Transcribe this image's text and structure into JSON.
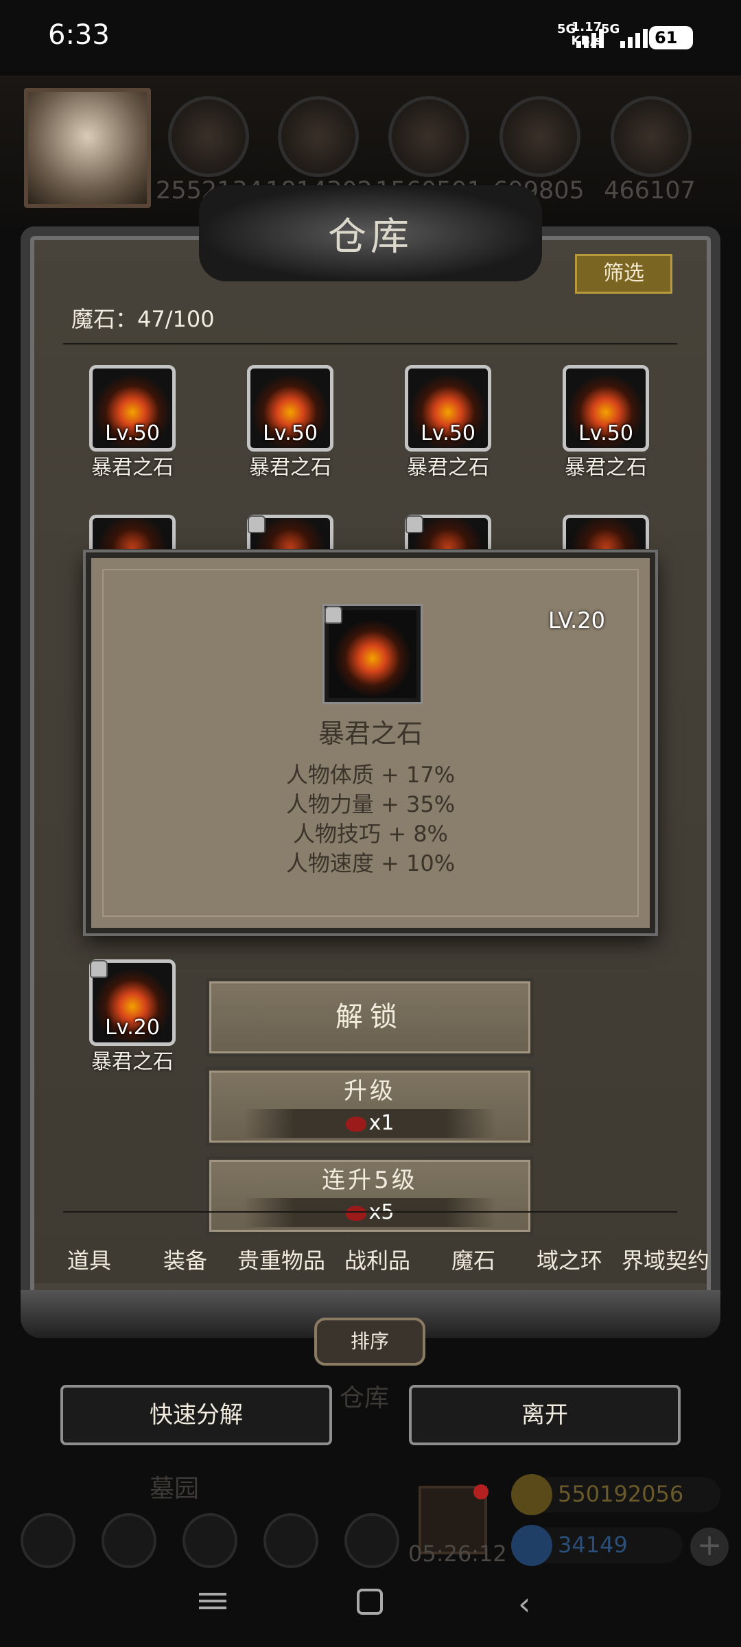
{
  "status_bar": {
    "time": "6:33",
    "net_speed": "1.17",
    "net_unit": "KB/s",
    "sig1": "5G",
    "sig2": "5G",
    "battery": "61"
  },
  "resources": [
    "2552134",
    "1814302",
    "1560591",
    "699805",
    "466107"
  ],
  "warehouse": {
    "title": "仓库",
    "filter_label": "筛选",
    "count_label": "魔石：47/100"
  },
  "items": [
    {
      "level": "Lv.50",
      "name": "暴君之石"
    },
    {
      "level": "Lv.50",
      "name": "暴君之石"
    },
    {
      "level": "Lv.50",
      "name": "暴君之石"
    },
    {
      "level": "Lv.50",
      "name": "暴君之石"
    }
  ],
  "selected_item": {
    "level": "Lv.20",
    "name": "暴君之石"
  },
  "popup": {
    "level": "LV.20",
    "name": "暴君之石",
    "stats": [
      "人物体质 + 17%",
      "人物力量 + 35%",
      "人物技巧 + 8%",
      "人物速度 + 10%"
    ]
  },
  "actions": {
    "unlock": "解锁",
    "upgrade": "升级",
    "upgrade_cost": "x1",
    "upgrade5": "连升5级",
    "upgrade5_cost": "x5"
  },
  "tabs": [
    "道具",
    "装备",
    "贵重物品",
    "战利品",
    "魔石",
    "域之环",
    "界域契约"
  ],
  "sort_label": "排序",
  "bottom_buttons": {
    "decompose": "快速分解",
    "leave": "离开"
  },
  "background": {
    "warehouse": "仓库",
    "cemetery": "墓园",
    "timer": "05:26:12",
    "gold": "550192056",
    "gems": "34149",
    "plus": "+"
  },
  "colors": {
    "gold_text": "#6a5a2a",
    "gem_text": "#2a4f7a",
    "filter_bg": "#7a6522"
  }
}
